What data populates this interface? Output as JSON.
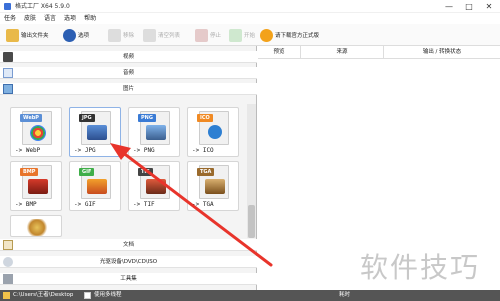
{
  "window": {
    "title": "格式工厂 X64 5.9.0",
    "min": "—",
    "max": "□",
    "close": "✕"
  },
  "menu": [
    "任务",
    "皮肤",
    "语言",
    "选项",
    "帮助"
  ],
  "toolbar": {
    "output_folder": "输出文件夹",
    "options": "选项",
    "remove": "移除",
    "clear_list": "清空列表",
    "stop": "停止",
    "start": "开始",
    "download": "请下载官方正式版"
  },
  "categories": {
    "video": "视频",
    "audio": "音频",
    "image": "图片",
    "document": "文档",
    "rom": "光驱设备\\DVD\\CD\\ISO",
    "tools": "工具集"
  },
  "tiles": [
    {
      "tag": "WebP",
      "label": "-> WebP",
      "tag_color": "#5b8fd6"
    },
    {
      "tag": "JPG",
      "label": "-> JPG",
      "tag_color": "#333333"
    },
    {
      "tag": "PNG",
      "label": "-> PNG",
      "tag_color": "#3a7bd5"
    },
    {
      "tag": "ICO",
      "label": "-> ICO",
      "tag_color": "#f08a24"
    },
    {
      "tag": "BMP",
      "label": "-> BMP",
      "tag_color": "#e8742a"
    },
    {
      "tag": "GIF",
      "label": "-> GIF",
      "tag_color": "#3fae49"
    },
    {
      "tag": "TIF",
      "label": "-> TIF",
      "tag_color": "#444444"
    },
    {
      "tag": "TGA",
      "label": "-> TGA",
      "tag_color": "#9a6a2c"
    }
  ],
  "table_headers": [
    "预览",
    "来源",
    "输出 / 转换状态"
  ],
  "watermark": "软件技巧",
  "status": {
    "path": "C:\\Users\\王者\\Desktop",
    "multithread": "使用多线程",
    "right": "耗时"
  }
}
